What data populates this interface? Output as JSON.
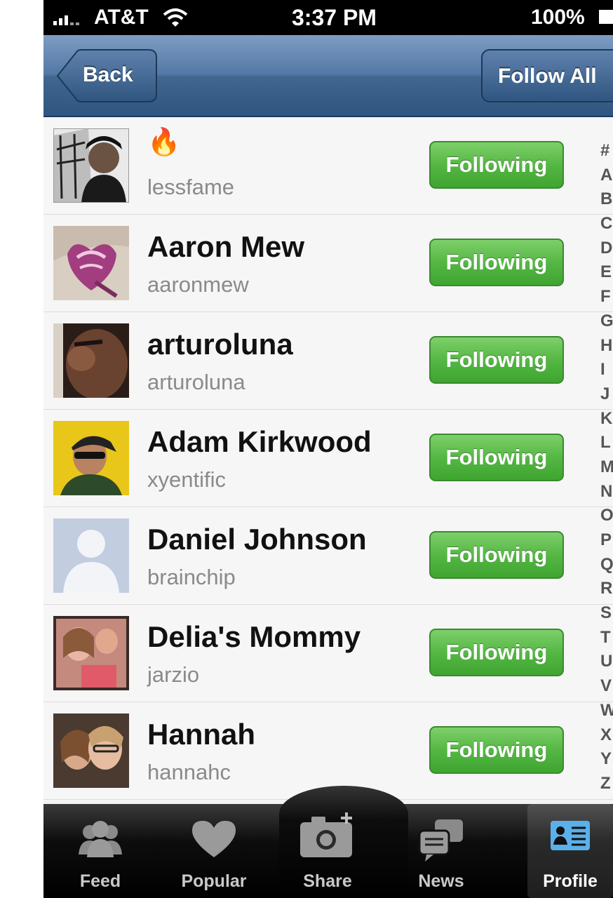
{
  "status_bar": {
    "carrier": "AT&T",
    "time": "3:37 PM",
    "battery": "100%"
  },
  "nav": {
    "back_label": "Back",
    "follow_all_label": "Follow All"
  },
  "users": [
    {
      "name": "🔥",
      "username": "lessfame",
      "button": "Following"
    },
    {
      "name": "Aaron Mew",
      "username": "aaronmew",
      "button": "Following"
    },
    {
      "name": "arturoluna",
      "username": "arturoluna",
      "button": "Following"
    },
    {
      "name": "Adam Kirkwood",
      "username": "xyentific",
      "button": "Following"
    },
    {
      "name": "Daniel Johnson",
      "username": "brainchip",
      "button": "Following"
    },
    {
      "name": "Delia's Mommy",
      "username": "jarzio",
      "button": "Following"
    },
    {
      "name": "Hannah",
      "username": "hannahc",
      "button": "Following"
    }
  ],
  "index": [
    "#",
    "A",
    "B",
    "C",
    "D",
    "E",
    "F",
    "G",
    "H",
    "I",
    "J",
    "K",
    "L",
    "M",
    "N",
    "O",
    "P",
    "Q",
    "R",
    "S",
    "T",
    "U",
    "V",
    "W",
    "X",
    "Y",
    "Z"
  ],
  "tabs": [
    {
      "label": "Feed",
      "icon": "people-icon"
    },
    {
      "label": "Popular",
      "icon": "heart-icon"
    },
    {
      "label": "Share",
      "icon": "camera-icon"
    },
    {
      "label": "News",
      "icon": "speech-bubbles-icon"
    },
    {
      "label": "Profile",
      "icon": "profile-card-icon"
    }
  ],
  "active_tab": "Profile",
  "colors": {
    "nav": "#4a6f9a",
    "following_button": "#55b744",
    "tab_bar": "#000000"
  }
}
